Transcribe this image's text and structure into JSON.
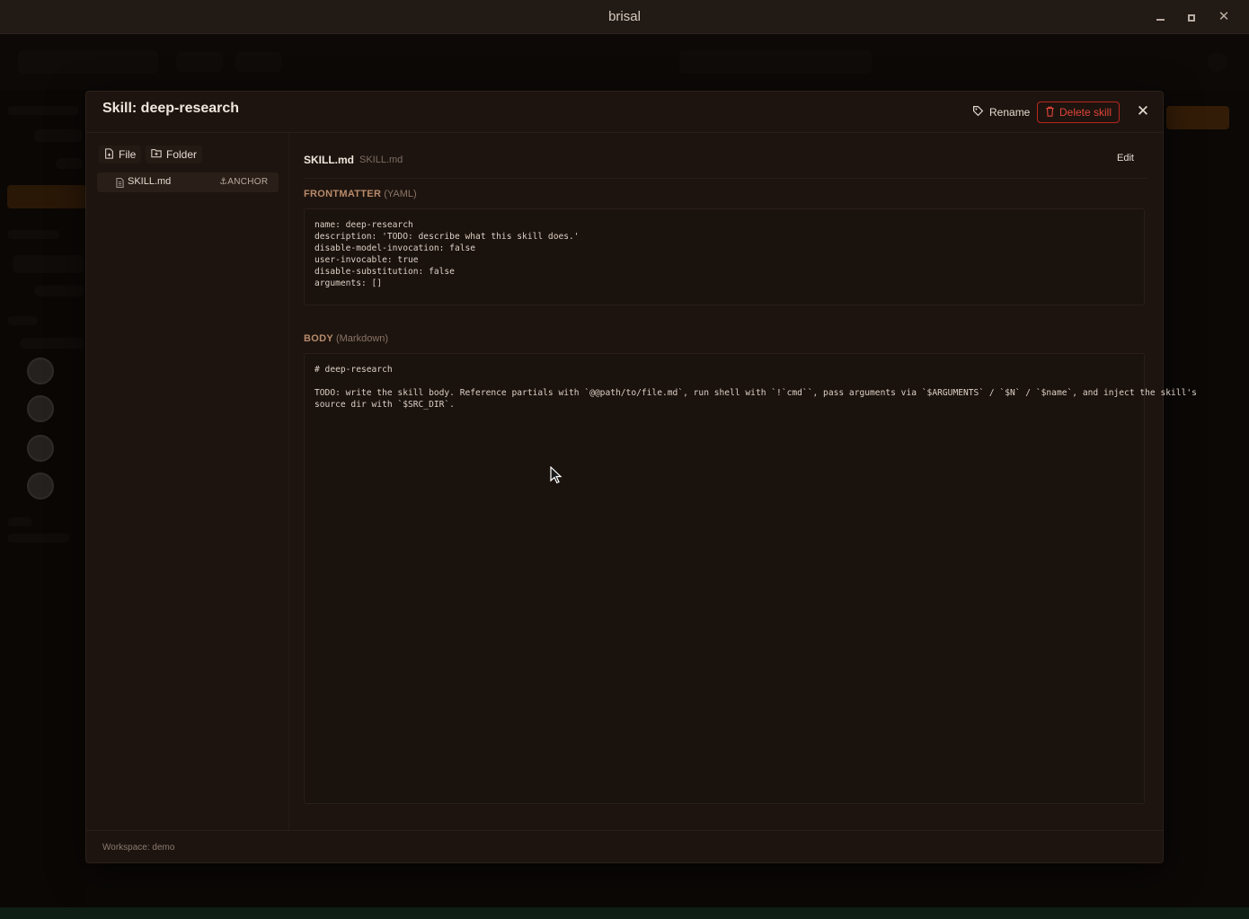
{
  "window": {
    "title": "brisal"
  },
  "modal": {
    "title": "Skill: deep-research",
    "rename_label": "Rename",
    "delete_label": "Delete skill",
    "close_icon": "close-icon"
  },
  "file_panel": {
    "file_button": "File",
    "folder_button": "Folder",
    "items": [
      {
        "name": "SKILL.md",
        "tag": "ANCHOR"
      }
    ]
  },
  "editor": {
    "file_name": "SKILL.md",
    "file_path": "SKILL.md",
    "edit_label": "Edit",
    "frontmatter": {
      "label": "FRONTMATTER",
      "sub": "(YAML)",
      "content": "name: deep-research\ndescription: 'TODO: describe what this skill does.'\ndisable-model-invocation: false\nuser-invocable: true\ndisable-substitution: false\narguments: []"
    },
    "body": {
      "label": "BODY",
      "sub": "(Markdown)",
      "content": "# deep-research\n\nTODO: write the skill body. Reference partials with `@@path/to/file.md`, run shell with `!`cmd``, pass arguments via `$ARGUMENTS` / `$N` / `$name`, and inject the skill's\nsource dir with `$SRC_DIR`."
    }
  },
  "footer": {
    "workspace": "Workspace: demo"
  },
  "colors": {
    "accent_danger": "#e0443a",
    "section_label": "#b88a6a",
    "modal_bg": "#1d140f"
  }
}
